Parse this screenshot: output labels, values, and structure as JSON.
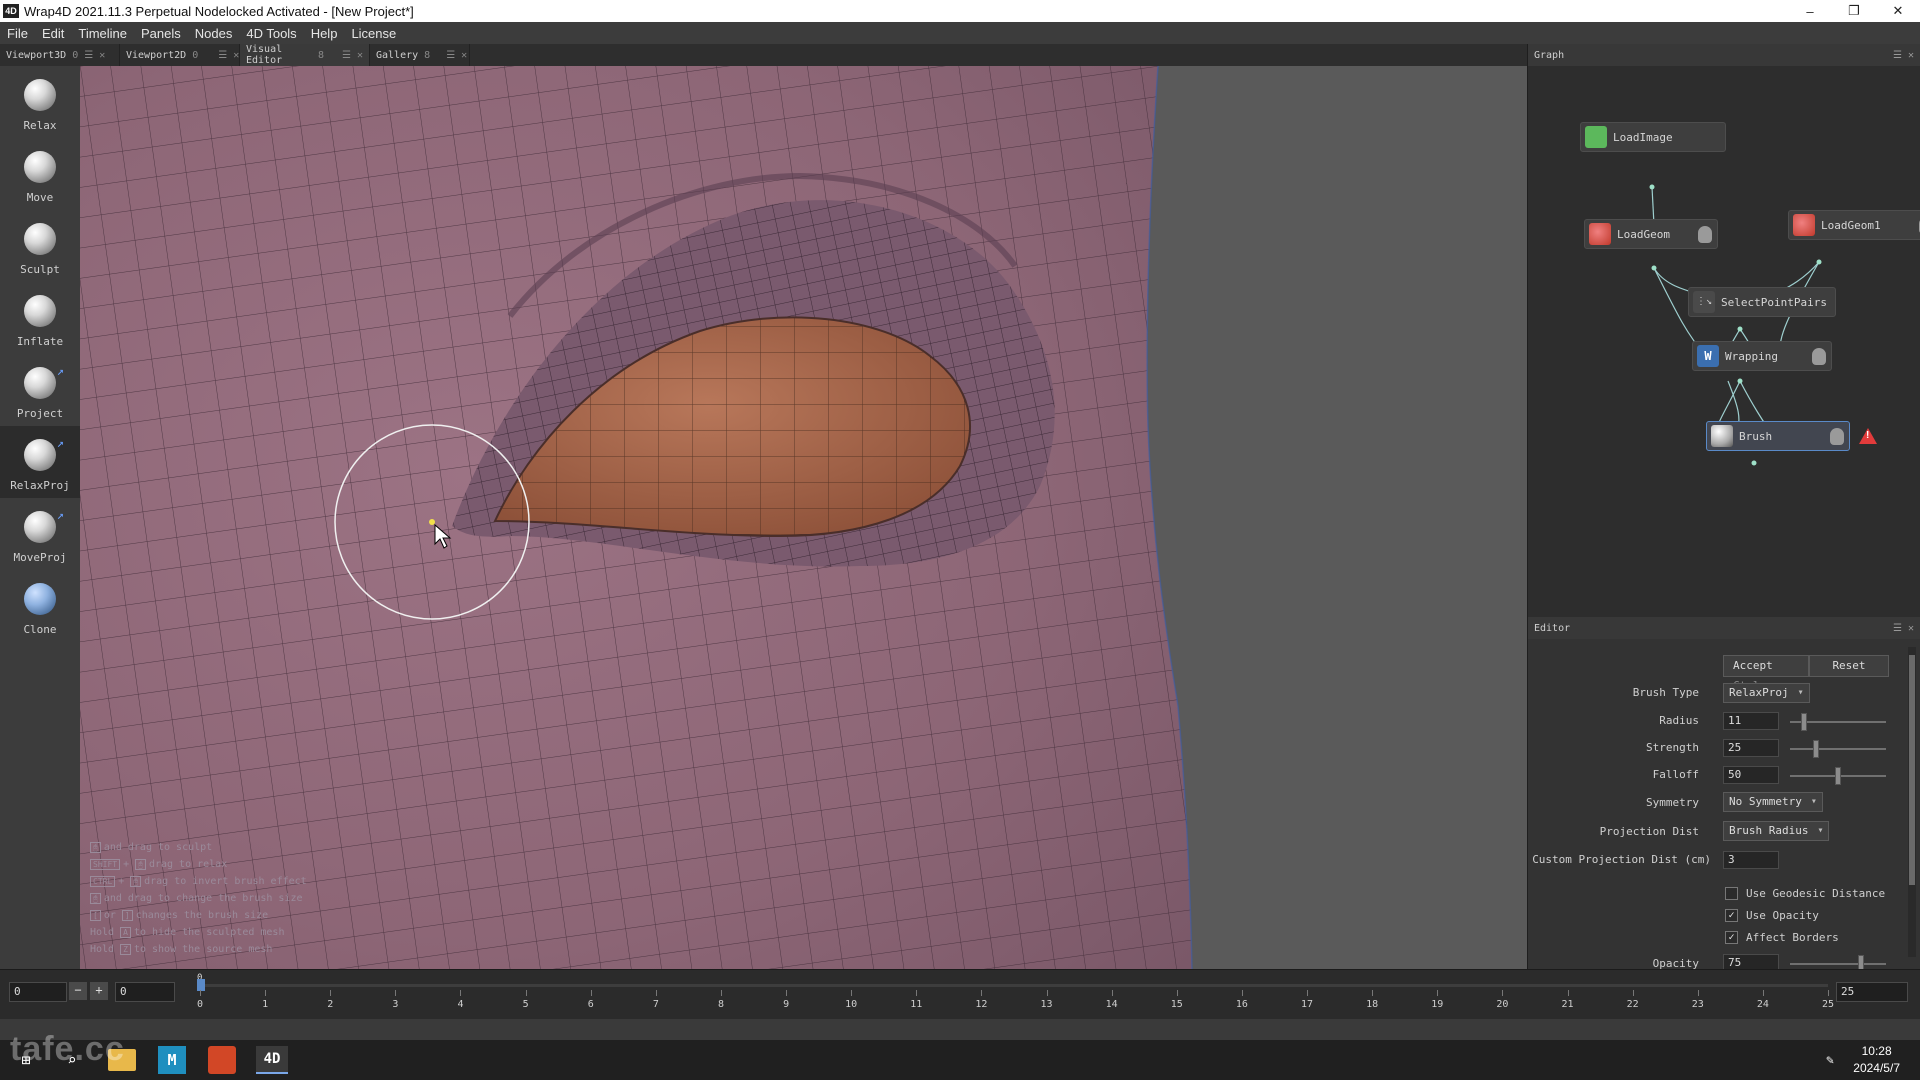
{
  "window": {
    "app_badge": "4D",
    "title": "Wrap4D 2021.11.3   Perpetual Nodelocked Activated  - [New Project*]",
    "minimize": "–",
    "maximize": "❐",
    "close": "✕"
  },
  "menu": [
    "File",
    "Edit",
    "Timeline",
    "Panels",
    "Nodes",
    "4D Tools",
    "Help",
    "License"
  ],
  "tabs": [
    {
      "label": "Viewport3D",
      "suffix": "0",
      "active": false
    },
    {
      "label": "Viewport2D",
      "suffix": "0",
      "active": false
    },
    {
      "label": "Visual Editor",
      "suffix": "8",
      "active": true
    },
    {
      "label": "Gallery",
      "suffix": "8",
      "active": false
    }
  ],
  "tools": [
    {
      "label": "Relax"
    },
    {
      "label": "Move"
    },
    {
      "label": "Sculpt"
    },
    {
      "label": "Inflate"
    },
    {
      "label": "Project"
    },
    {
      "label": "RelaxProj",
      "active": true
    },
    {
      "label": "MoveProj"
    },
    {
      "label": "Clone"
    }
  ],
  "viewport": {
    "hints": [
      {
        "keys": [
          "🖰"
        ],
        "text": "and drag to sculpt"
      },
      {
        "keys": [
          "SHIFT",
          "🖰"
        ],
        "text": "drag to relax"
      },
      {
        "keys": [
          "CTRL",
          "🖰"
        ],
        "text": "drag to invert brush effect"
      },
      {
        "keys": [
          "🖰"
        ],
        "text": "and drag to change the brush size"
      },
      {
        "keys": [
          "[",
          "]"
        ],
        "text": "changes the brush size"
      },
      {
        "keys": [
          "A"
        ],
        "prefix": "Hold",
        "text": "to hide the sculpted mesh"
      },
      {
        "keys": [
          "Z"
        ],
        "prefix": "Hold",
        "text": "to show the source mesh"
      }
    ]
  },
  "graph": {
    "title": "Graph",
    "nodes": [
      {
        "id": "loadimage",
        "label": "LoadImage",
        "icon": "image-icon",
        "color": "#5cb85c"
      },
      {
        "id": "loadgeom",
        "label": "LoadGeom",
        "icon": "geom-icon",
        "color": "#d9534f"
      },
      {
        "id": "loadgeom1",
        "label": "LoadGeom1",
        "icon": "geom-icon",
        "color": "#d9534f"
      },
      {
        "id": "selectpointpairs",
        "label": "SelectPointPairs",
        "icon": "select-icon",
        "color": "#888888"
      },
      {
        "id": "wrapping",
        "label": "Wrapping",
        "icon": "wrap-icon",
        "color": "#4a90d9"
      },
      {
        "id": "brush",
        "label": "Brush",
        "icon": "brush-icon",
        "color": "#bbbbbb"
      }
    ],
    "warning": "!"
  },
  "editor": {
    "title": "Editor",
    "accept_label": "Accept",
    "accept_shortcut": "Ctrl+",
    "reset_label": "Reset",
    "brush_type_label": "Brush Type",
    "brush_type_value": "RelaxProj",
    "radius_label": "Radius",
    "radius_value": "11",
    "radius_level": 0.12,
    "strength_label": "Strength",
    "strength_value": "25",
    "strength_level": 0.25,
    "falloff_label": "Falloff",
    "falloff_value": "50",
    "falloff_level": 0.5,
    "symmetry_label": "Symmetry",
    "symmetry_value": "No Symmetry",
    "projection_dist_label": "Projection Dist",
    "projection_dist_value": "Brush Radius",
    "custom_proj_label": "Custom Projection Dist (cm)",
    "custom_proj_value": "3",
    "use_geodesic_label": "Use Geodesic Distance",
    "use_geodesic": false,
    "use_opacity_label": "Use Opacity",
    "use_opacity": true,
    "affect_borders_label": "Affect Borders",
    "affect_borders": true,
    "opacity_label": "Opacity",
    "opacity_value": "75",
    "opacity_level": 0.75
  },
  "timeline": {
    "current_frame": "0",
    "start_frame": "0",
    "marker": "0",
    "end_frame": "25",
    "minus": "−",
    "plus": "+",
    "ticks": [
      "0",
      "1",
      "2",
      "3",
      "4",
      "5",
      "6",
      "7",
      "8",
      "9",
      "10",
      "11",
      "12",
      "13",
      "14",
      "15",
      "16",
      "17",
      "18",
      "19",
      "20",
      "21",
      "22",
      "23",
      "24",
      "25"
    ]
  },
  "taskbar": {
    "time": "10:28",
    "date": "2024/5/7",
    "watermark": "tafe.cc",
    "pinned": [
      "start-icon",
      "search-icon",
      "file-explorer-icon",
      "maya-icon",
      "office-icon",
      "wrap4d-icon"
    ],
    "app_label": "4D",
    "maya_label": "M"
  }
}
